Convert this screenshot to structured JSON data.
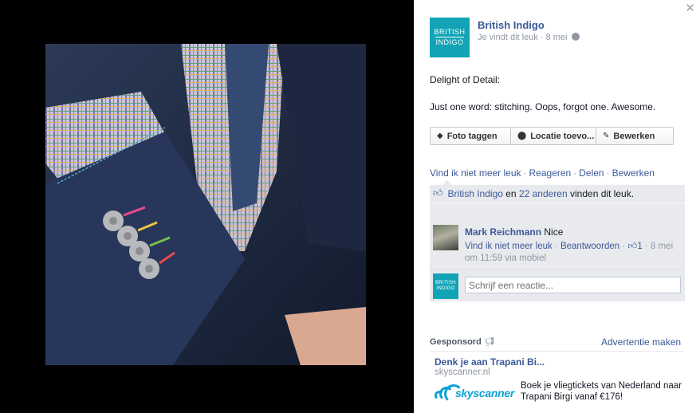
{
  "photo": {
    "alt_subject": "suit sleeve with colorful stitched buttonholes"
  },
  "panel": {
    "close_icon": "close-icon",
    "page": {
      "avatar_line1": "BRITISH",
      "avatar_line2": "INDIGO",
      "name": "British Indigo",
      "meta": "Je vindt dit leuk · 8 mei"
    },
    "post": {
      "line1": "Delight of Detail:",
      "line2": "Just one word: stitching. Oops, forgot one. Awesome."
    },
    "actions": {
      "tag": "Foto taggen",
      "location": "Locatie toevo...",
      "edit": "Bewerken"
    },
    "links": {
      "unlike": "Vind ik niet meer leuk",
      "comment": "Reageren",
      "share": "Delen",
      "edit": "Bewerken"
    },
    "likes": {
      "page_link": "British Indigo",
      "joiner": " en ",
      "others_link": "22 anderen",
      "suffix": " vinden dit leuk."
    },
    "comment": {
      "author": "Mark Reichmann",
      "text": "Nice",
      "unlike": "Vind ik niet meer leuk",
      "reply": "Beantwoorden",
      "like_count": "1",
      "date": "8 mei",
      "time_line": "om 11:59 via mobiel"
    },
    "reply_box": {
      "avatar_line1": "BRITISH",
      "avatar_line2": "INDIGO",
      "placeholder": "Schrijf een reactie..."
    }
  },
  "sponsored": {
    "heading": "Gesponsord",
    "create_ad": "Advertentie maken",
    "ad": {
      "title": "Denk je aan Trapani Bi...",
      "domain": "skyscanner.nl",
      "logo_word": "skyscanner",
      "description": "Boek je vliegtickets van Nederland naar Trapani Birgi vanaf €176!"
    }
  },
  "colors": {
    "brand_teal": "#12a4b6",
    "facebook_blue": "#3b5998",
    "skyscanner_blue": "#0aa3d6"
  }
}
